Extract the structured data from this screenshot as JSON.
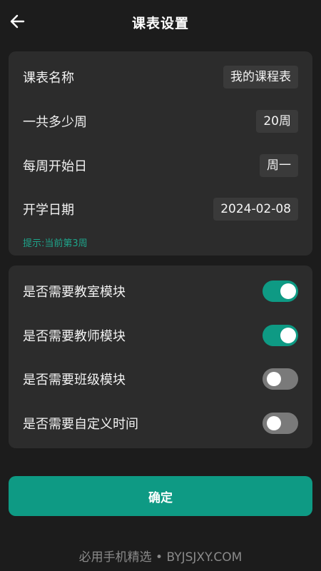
{
  "header": {
    "title": "课表设置",
    "back_icon": "arrow-left-icon"
  },
  "settings": {
    "rows": [
      {
        "label": "课表名称",
        "value": "我的课程表"
      },
      {
        "label": "一共多少周",
        "value": "20周"
      },
      {
        "label": "每周开始日",
        "value": "周一"
      },
      {
        "label": "开学日期",
        "value": "2024-02-08"
      }
    ],
    "hint": "提示:当前第3周"
  },
  "toggles": [
    {
      "label": "是否需要教室模块",
      "on": true
    },
    {
      "label": "是否需要教师模块",
      "on": true
    },
    {
      "label": "是否需要班级模块",
      "on": false
    },
    {
      "label": "是否需要自定义时间",
      "on": false
    }
  ],
  "confirm_label": "确定",
  "watermark": "必用手机精选 • BYJSJXY.COM",
  "colors": {
    "background": "#1c1c1c",
    "card": "#2c2c2c",
    "accent": "#0e9a84",
    "toggle_off": "#7a7a7a",
    "hint": "#1ea58b"
  }
}
